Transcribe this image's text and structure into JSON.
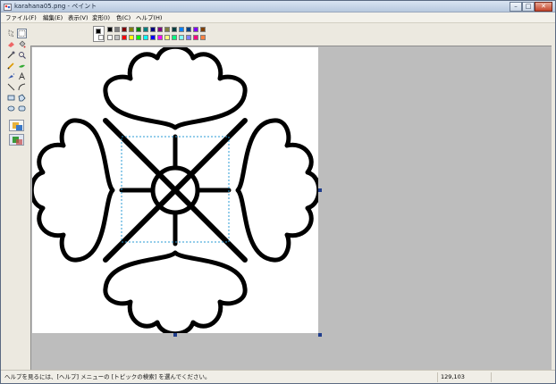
{
  "window": {
    "title": "karahana05.png - ペイント",
    "buttons": {
      "minimize": "–",
      "maximize": "□",
      "close": "✕"
    }
  },
  "menu": [
    "ファイル(F)",
    "編集(E)",
    "表示(V)",
    "変形(I)",
    "色(C)",
    "ヘルプ(H)"
  ],
  "palette": {
    "foreground": "#000000",
    "background": "#ffffff",
    "colors": [
      "#000000",
      "#808080",
      "#800000",
      "#808000",
      "#008000",
      "#008080",
      "#000080",
      "#800080",
      "#808040",
      "#004040",
      "#0080ff",
      "#004080",
      "#8000ff",
      "#804000",
      "#ffffff",
      "#c0c0c0",
      "#ff0000",
      "#ffff00",
      "#00ff00",
      "#00ffff",
      "#0000ff",
      "#ff00ff",
      "#ffff80",
      "#00ff80",
      "#80ffff",
      "#8080ff",
      "#ff0080",
      "#ff8040"
    ]
  },
  "tools": [
    {
      "name": "free-select"
    },
    {
      "name": "rect-select"
    },
    {
      "name": "eraser"
    },
    {
      "name": "fill"
    },
    {
      "name": "color-picker"
    },
    {
      "name": "magnifier"
    },
    {
      "name": "pencil"
    },
    {
      "name": "brush"
    },
    {
      "name": "airbrush"
    },
    {
      "name": "text"
    },
    {
      "name": "line"
    },
    {
      "name": "curve"
    },
    {
      "name": "rectangle"
    },
    {
      "name": "polygon"
    },
    {
      "name": "ellipse"
    },
    {
      "name": "rounded-rect"
    }
  ],
  "status": {
    "help": "ヘルプを見るには、[ヘルプ] メニューの [トピックの検索] を選んでください。",
    "coords": "129,103"
  }
}
